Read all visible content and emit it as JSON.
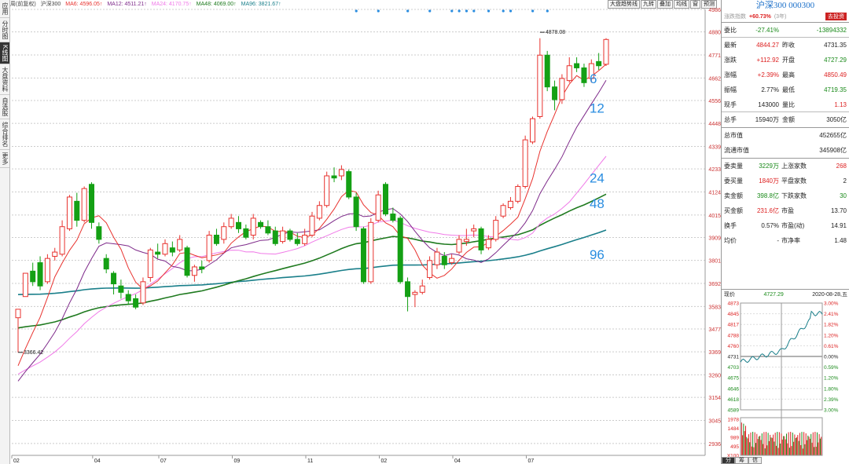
{
  "left_tabs": [
    {
      "label": "应用",
      "active": false
    },
    {
      "label": "分时图",
      "active": false
    },
    {
      "label": "K线图",
      "active": true
    },
    {
      "label": "大盘资料",
      "active": false
    },
    {
      "label": "自选股",
      "active": false
    },
    {
      "label": "综合排名",
      "active": false
    },
    {
      "label": "更多",
      "active": false
    }
  ],
  "ma_bar": {
    "mode": "周(前复权)",
    "name": "沪深300",
    "ma6": "MA6: 4596.05↑",
    "ma12": "MA12: 4511.21↑",
    "ma24": "MA24: 4170.75↑",
    "ma48": "MA48: 4069.00↑",
    "ma96": "MA96: 3821.67↑"
  },
  "toolbar": [
    "大盘趋势线",
    "九转",
    "叠加",
    "均线",
    "窗",
    "预测"
  ],
  "colors": {
    "ma6": "#e8322e",
    "ma12": "#7e2a8a",
    "ma24": "#f07ae8",
    "ma48": "#1f7a1f",
    "ma96": "#1a7f8a",
    "up": "#e8322e",
    "down": "#14a014",
    "label": "#2a8de0"
  },
  "chart_data": {
    "type": "candlestick",
    "y_ticks": [
      4986,
      4880,
      4771,
      4662,
      4556,
      4448,
      4339,
      4233,
      4124,
      4015,
      3909,
      3801,
      3692,
      3583,
      3477,
      3369,
      3260,
      3154,
      3045,
      2936
    ],
    "ylim": [
      2880,
      4986
    ],
    "x_labels": [
      {
        "i": 0,
        "label": "02"
      },
      {
        "i": 11,
        "label": "04"
      },
      {
        "i": 20,
        "label": "07"
      },
      {
        "i": 30,
        "label": "09"
      },
      {
        "i": 40,
        "label": "11"
      },
      {
        "i": 50,
        "label": "02"
      },
      {
        "i": 60,
        "label": "04"
      },
      {
        "i": 70,
        "label": "07"
      }
    ],
    "annotations": {
      "high": "4878.08",
      "low": "3366.42",
      "high_index": 71,
      "high_value": 4878.08,
      "low_index": 0,
      "low_value": 3366.42
    },
    "ma_labels": [
      {
        "text": "6",
        "i": 77,
        "v": 4660
      },
      {
        "text": "12",
        "i": 77,
        "v": 4520
      },
      {
        "text": "24",
        "i": 77,
        "v": 4190
      },
      {
        "text": "48",
        "i": 77,
        "v": 4070
      },
      {
        "text": "96",
        "i": 77,
        "v": 3830
      }
    ],
    "candles": [
      [
        3530,
        3570,
        3380,
        3366
      ],
      [
        3630,
        3740,
        3630,
        3740
      ],
      [
        3750,
        3700,
        3790,
        3680
      ],
      [
        3790,
        3680,
        3820,
        3660
      ],
      [
        3700,
        3810,
        3690,
        3830
      ],
      [
        3820,
        3840,
        3800,
        3860
      ],
      [
        3830,
        3960,
        3820,
        3990
      ],
      [
        3950,
        4100,
        3940,
        4110
      ],
      [
        4080,
        3990,
        4120,
        3960
      ],
      [
        3990,
        4140,
        3980,
        4150
      ],
      [
        4160,
        3980,
        4170,
        3950
      ],
      [
        3960,
        3900,
        3980,
        3880
      ],
      [
        3810,
        3760,
        3830,
        3740
      ],
      [
        3740,
        3690,
        3750,
        3640
      ],
      [
        3680,
        3650,
        3710,
        3620
      ],
      [
        3640,
        3610,
        3660,
        3590
      ],
      [
        3620,
        3580,
        3640,
        3570
      ],
      [
        3600,
        3700,
        3590,
        3720
      ],
      [
        3720,
        3850,
        3700,
        3860
      ],
      [
        3840,
        3830,
        3880,
        3810
      ],
      [
        3830,
        3880,
        3820,
        3900
      ],
      [
        3860,
        3840,
        3890,
        3820
      ],
      [
        3850,
        3900,
        3840,
        3920
      ],
      [
        3860,
        3730,
        3870,
        3720
      ],
      [
        3730,
        3770,
        3700,
        3780
      ],
      [
        3770,
        3760,
        3800,
        3740
      ],
      [
        3800,
        3920,
        3790,
        3940
      ],
      [
        3920,
        3880,
        3950,
        3870
      ],
      [
        3900,
        3960,
        3880,
        3980
      ],
      [
        3960,
        4000,
        3950,
        4020
      ],
      [
        3980,
        3950,
        4010,
        3930
      ],
      [
        3950,
        3910,
        3970,
        3900
      ],
      [
        3920,
        4000,
        3900,
        4020
      ],
      [
        3980,
        3960,
        3990,
        3950
      ],
      [
        3960,
        3930,
        3990,
        3920
      ],
      [
        3940,
        3880,
        3960,
        3870
      ],
      [
        3890,
        3940,
        3880,
        3960
      ],
      [
        3940,
        3900,
        3950,
        3890
      ],
      [
        3900,
        3880,
        3930,
        3870
      ],
      [
        3880,
        3920,
        3870,
        3950
      ],
      [
        3920,
        4010,
        3910,
        4030
      ],
      [
        4000,
        4060,
        3990,
        4080
      ],
      [
        4060,
        4200,
        4050,
        4220
      ],
      [
        4200,
        4190,
        4240,
        4170
      ],
      [
        4200,
        4230,
        4180,
        4250
      ],
      [
        4220,
        4100,
        4230,
        4090
      ],
      [
        4100,
        3960,
        4120,
        3940
      ],
      [
        3950,
        3700,
        3960,
        3690
      ],
      [
        3700,
        3980,
        3690,
        4000
      ],
      [
        3990,
        4110,
        3980,
        4130
      ],
      [
        4160,
        4020,
        4170,
        4010
      ],
      [
        4020,
        3990,
        4050,
        3980
      ],
      [
        4000,
        3700,
        4010,
        3690
      ],
      [
        3700,
        3630,
        3720,
        3560
      ],
      [
        3640,
        3650,
        3660,
        3580
      ],
      [
        3650,
        3680,
        3640,
        3710
      ],
      [
        3720,
        3800,
        3710,
        3820
      ],
      [
        3780,
        3840,
        3760,
        3860
      ],
      [
        3820,
        3780,
        3840,
        3760
      ],
      [
        3790,
        3810,
        3780,
        3830
      ],
      [
        3840,
        3900,
        3830,
        3920
      ],
      [
        3890,
        3900,
        3870,
        3950
      ],
      [
        3940,
        3950,
        3910,
        3970
      ],
      [
        3950,
        3850,
        3960,
        3830
      ],
      [
        3860,
        3900,
        3850,
        3920
      ],
      [
        3900,
        3990,
        3890,
        4010
      ],
      [
        4010,
        4060,
        4000,
        4070
      ],
      [
        4050,
        4080,
        4040,
        4100
      ],
      [
        4080,
        4150,
        4070,
        4160
      ],
      [
        4150,
        4370,
        4140,
        4390
      ],
      [
        4360,
        4470,
        4350,
        4480
      ],
      [
        4480,
        4770,
        4470,
        4850
      ],
      [
        4770,
        4620,
        4790,
        4600
      ],
      [
        4620,
        4560,
        4650,
        4510
      ],
      [
        4560,
        4660,
        4540,
        4680
      ],
      [
        4650,
        4720,
        4640,
        4760
      ],
      [
        4730,
        4710,
        4760,
        4690
      ],
      [
        4710,
        4640,
        4730,
        4620
      ],
      [
        4660,
        4730,
        4640,
        4750
      ],
      [
        4740,
        4720,
        4780,
        4700
      ],
      [
        4727,
        4844,
        4719,
        4850
      ]
    ]
  },
  "side": {
    "title": "沪深300 000300",
    "index_label": "涨跌指数",
    "index_pct": "+60.73%",
    "index_period": "(3年)",
    "go_button": "去投资",
    "rows": [
      {
        "k": "委比",
        "v1": "-27.41%",
        "v1c": "green",
        "k2": "",
        "v2": "-13894332",
        "v2c": "green"
      },
      {
        "k": "最新",
        "v1": "4844.27",
        "v1c": "red",
        "k2": "昨收",
        "v2": "4731.35",
        "v2c": "blk"
      },
      {
        "k": "涨跌",
        "v1": "+112.92",
        "v1c": "red",
        "k2": "开盘",
        "v2": "4727.29",
        "v2c": "green"
      },
      {
        "k": "涨幅",
        "v1": "+2.39%",
        "v1c": "red",
        "k2": "最高",
        "v2": "4850.49",
        "v2c": "red"
      },
      {
        "k": "振幅",
        "v1": "2.77%",
        "v1c": "blk",
        "k2": "最低",
        "v2": "4719.35",
        "v2c": "green"
      },
      {
        "k": "现手",
        "v1": "143000",
        "v1c": "blk",
        "k2": "量比",
        "v2": "1.13",
        "v2c": "red"
      },
      {
        "k": "总手",
        "v1": "15940万",
        "v1c": "blk",
        "k2": "金额",
        "v2": "3050亿",
        "v2c": "blk"
      }
    ],
    "wide_rows": [
      {
        "k": "总市值",
        "v": "452655亿"
      },
      {
        "k": "流通市值",
        "v": "345908亿"
      }
    ],
    "market_rows": [
      {
        "k": "委卖量",
        "v1": "3229万",
        "v1c": "green",
        "k2": "上涨家数",
        "v2": "268",
        "v2c": "red"
      },
      {
        "k": "委买量",
        "v1": "1840万",
        "v1c": "red",
        "k2": "平盘家数",
        "v2": "2",
        "v2c": "blk"
      },
      {
        "k": "卖金额",
        "v1": "398.8亿",
        "v1c": "green",
        "k2": "下跌家数",
        "v2": "30",
        "v2c": "green"
      },
      {
        "k": "买金额",
        "v1": "231.6亿",
        "v1c": "red",
        "k2": "市盈",
        "v2": "13.70",
        "v2c": "blk"
      },
      {
        "k": "换手",
        "v1": "0.57%",
        "v1c": "blk",
        "k2": "市盈(动)",
        "v2": "14.91",
        "v2c": "blk"
      },
      {
        "k": "均价",
        "v1": "-",
        "v1c": "blk",
        "k2": "市净率",
        "v2": "1.48",
        "v2c": "blk"
      }
    ],
    "mini": {
      "label": "现价",
      "price": "4727.29",
      "date": "2020-08-28,五",
      "left_ticks": [
        "4873",
        "4845",
        "4817",
        "4788",
        "4760",
        "4731",
        "4703",
        "4675",
        "4646",
        "4618",
        "4589"
      ],
      "right_ticks": [
        "3.00%",
        "2.41%",
        "1.82%",
        "1.20%",
        "0.61%",
        "0.00%",
        "0.59%",
        "1.20%",
        "1.80%",
        "2.39%",
        "3.00%"
      ],
      "vol_ticks": [
        "1978",
        "1484",
        "989",
        "495",
        "X100"
      ],
      "tabs": [
        "分",
        "筹",
        "信"
      ]
    }
  }
}
